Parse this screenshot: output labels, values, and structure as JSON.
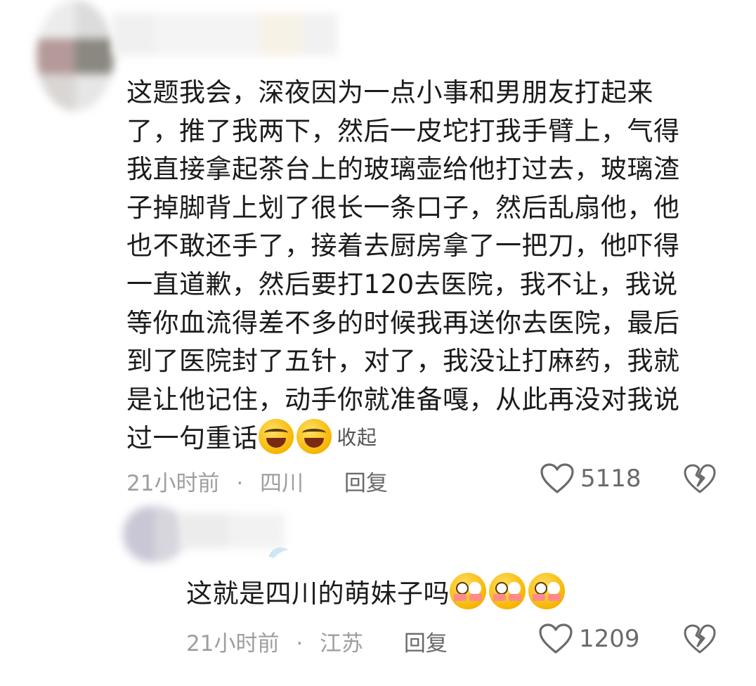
{
  "comments": [
    {
      "body_lines": [
        "这题我会，深夜因为一点小事和男朋友打起来",
        "了，推了我两下，然后一皮坨打我手臂上，气得",
        "我直接拿起茶台上的玻璃壶给他打过去，玻璃渣",
        "子掉脚背上划了很长一条口子，然后乱扇他，他",
        "也不敢还手了，接着去厨房拿了一把刀，他吓得",
        "一直道歉，然后要打120去医院，我不让，我说",
        "等你血流得差不多的时候我再送你去医院，最后",
        "到了医院封了五针，对了，我没让打麻药，我就",
        "是让他记住，动手你就准备嘎，从此再没对我说"
      ],
      "last_line": "过一句重话",
      "emojis": [
        "laughing-crying-emoji",
        "laughing-crying-emoji"
      ],
      "collapse_label": "收起",
      "time": "21小时前",
      "separator": "·",
      "location": "四川",
      "reply_label": "回复",
      "likes": "5118"
    },
    {
      "body": "这就是四川的萌妹子吗",
      "emojis": [
        "flushed-emoji",
        "flushed-emoji",
        "flushed-emoji"
      ],
      "time": "21小时前",
      "separator": "·",
      "location": "江苏",
      "reply_label": "回复",
      "likes": "1209"
    }
  ],
  "icons": {
    "like": "heart-outline-icon",
    "dislike": "broken-heart-icon"
  },
  "colors": {
    "text": "#1b1b1b",
    "meta": "#9e9e9e",
    "icon": "#6a6a6a"
  }
}
